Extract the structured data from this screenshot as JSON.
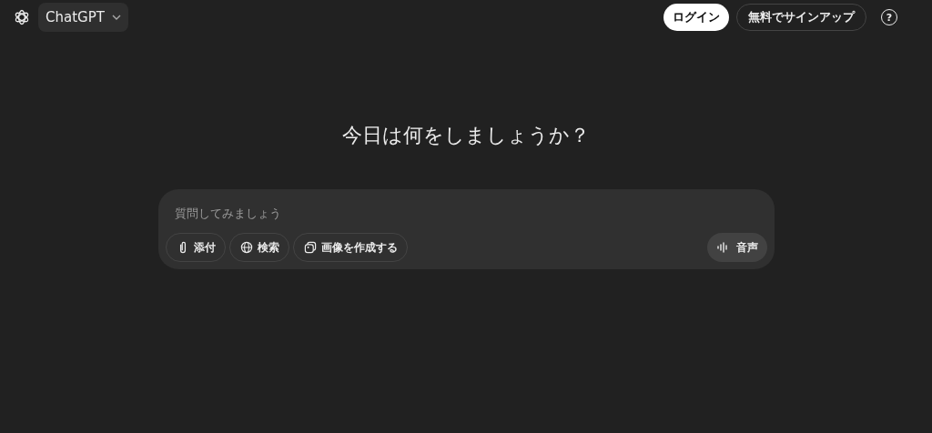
{
  "header": {
    "model_name": "ChatGPT",
    "login": "ログイン",
    "signup": "無料でサインアップ",
    "help": "?"
  },
  "heading": "今日は何をしましょうか？",
  "composer": {
    "placeholder": "質問してみましょう",
    "tools": [
      {
        "kind": "attach",
        "label": "添付"
      },
      {
        "kind": "search",
        "label": "検索"
      },
      {
        "kind": "image",
        "label": "画像を作成する"
      }
    ],
    "voice": "音声"
  }
}
